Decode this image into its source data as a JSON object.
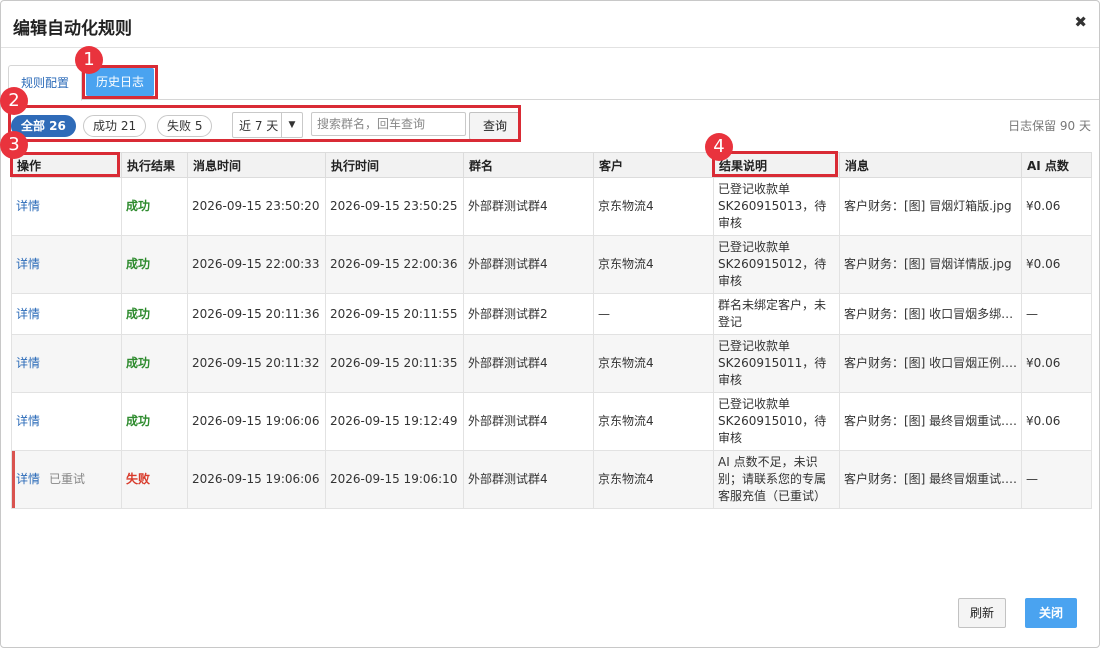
{
  "dialog": {
    "title": "编辑自动化规则",
    "close_glyph": "✖"
  },
  "tabs": [
    {
      "label": "规则配置"
    },
    {
      "label": "历史日志"
    }
  ],
  "filters": {
    "all_label": "全部 26",
    "success_label": "成功 21",
    "fail_label": "失败 5",
    "range_value": "近 7 天",
    "range_caret": "▼",
    "search_placeholder": "搜索群名，回车查询",
    "query_label": "查询",
    "retention_text": "日志保留 90 天"
  },
  "table": {
    "columns": [
      "操作",
      "执行结果",
      "消息时间",
      "执行时间",
      "群名",
      "客户",
      "结果说明",
      "消息",
      "AI 点数"
    ],
    "detail_label": "详情",
    "retried_label": "已重试",
    "rows": [
      {
        "status": "成功",
        "msg_time": "2026-09-15 23:50:20",
        "exec_time": "2026-09-15 23:50:25",
        "group": "外部群测试群4",
        "customer": "京东物流4",
        "result": "已登记收款单SK260915013，待审核",
        "message": "客户财务：[图] 冒烟灯箱版.jpg",
        "points": "¥0.06"
      },
      {
        "status": "成功",
        "msg_time": "2026-09-15 22:00:33",
        "exec_time": "2026-09-15 22:00:36",
        "group": "外部群测试群4",
        "customer": "京东物流4",
        "result": "已登记收款单SK260915012，待审核",
        "message": "客户财务：[图] 冒烟详情版.jpg",
        "points": "¥0.06"
      },
      {
        "status": "成功",
        "msg_time": "2026-09-15 20:11:36",
        "exec_time": "2026-09-15 20:11:55",
        "group": "外部群测试群2",
        "customer": "—",
        "result": "群名未绑定客户，未登记",
        "message": "客户财务：[图] 收口冒烟多绑…",
        "points": "—"
      },
      {
        "status": "成功",
        "msg_time": "2026-09-15 20:11:32",
        "exec_time": "2026-09-15 20:11:35",
        "group": "外部群测试群4",
        "customer": "京东物流4",
        "result": "已登记收款单SK260915011，待审核",
        "message": "客户财务：[图] 收口冒烟正例.j…",
        "points": "¥0.06"
      },
      {
        "status": "成功",
        "msg_time": "2026-09-15 19:06:06",
        "exec_time": "2026-09-15 19:12:49",
        "group": "外部群测试群4",
        "customer": "京东物流4",
        "result": "已登记收款单SK260915010，待审核",
        "message": "客户财务：[图] 最终冒烟重试.j…",
        "points": "¥0.06"
      },
      {
        "status": "失败",
        "msg_time": "2026-09-15 19:06:06",
        "exec_time": "2026-09-15 19:06:10",
        "group": "外部群测试群4",
        "customer": "京东物流4",
        "result": "AI 点数不足，未识别；请联系您的专属客服充值（已重试）",
        "message": "客户财务：[图] 最终冒烟重试.j…",
        "points": "—"
      }
    ]
  },
  "footer": {
    "refresh_label": "刷新",
    "close_label": "关闭"
  },
  "annotations": [
    "1",
    "2",
    "3",
    "4"
  ],
  "colors": {
    "accent": "#4aa3f0",
    "pill_active": "#2f6bb8",
    "success": "#2e8b2e",
    "fail": "#d83a2a",
    "annotation": "#d92b35"
  }
}
